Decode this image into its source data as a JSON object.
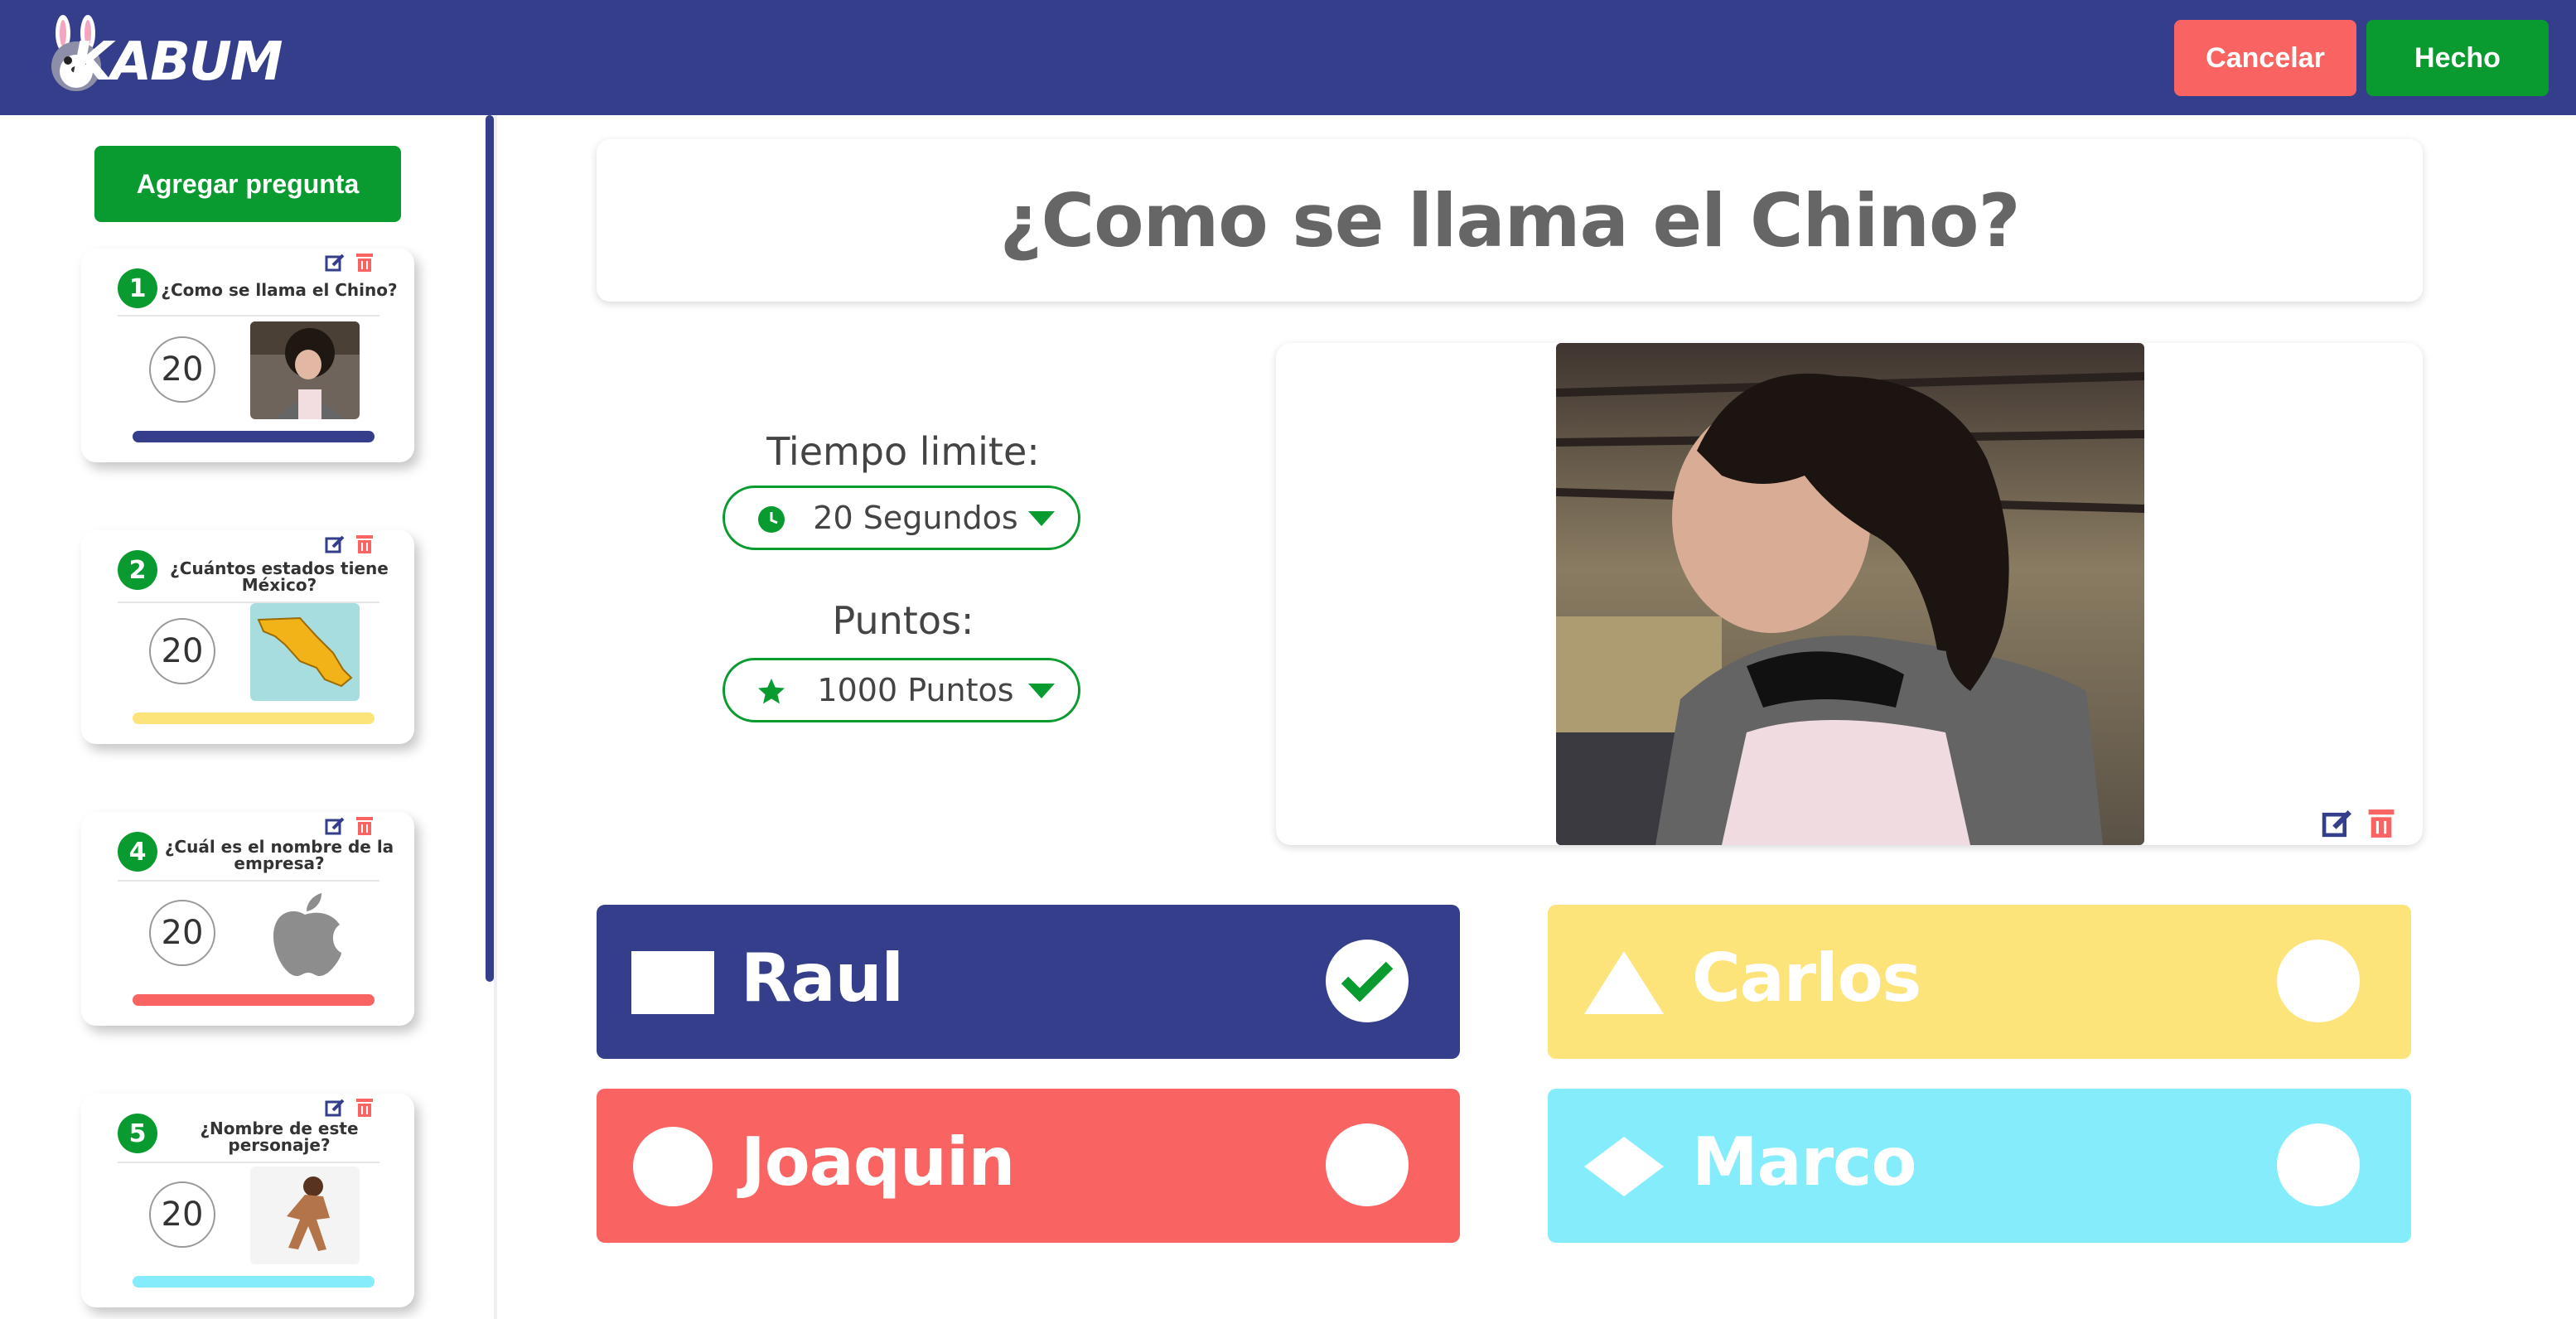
{
  "header": {
    "logo_text": "KABUM",
    "cancel_label": "Cancelar",
    "done_label": "Hecho"
  },
  "sidebar": {
    "add_label": "Agregar pregunta",
    "questions": [
      {
        "number": "1",
        "title": "¿Como se llama el Chino?",
        "time": "20",
        "color": "#343e8a"
      },
      {
        "number": "2",
        "title": "¿Cuántos estados tiene México?",
        "time": "20",
        "color": "#fde47a"
      },
      {
        "number": "4",
        "title": "¿Cuál es el nombre de la empresa?",
        "time": "20",
        "color": "#f96463"
      },
      {
        "number": "5",
        "title": "¿Nombre de este personaje?",
        "time": "20",
        "color": "#85ecfb"
      }
    ]
  },
  "main": {
    "question": "¿Como se llama el Chino?",
    "time_label": "Tiempo limite:",
    "time_value": "20 Segundos",
    "points_label": "Puntos:",
    "points_value": "1000 Puntos"
  },
  "answers": [
    {
      "text": "Raul",
      "shape": "square",
      "color": "#343e8a",
      "correct": true
    },
    {
      "text": "Carlos",
      "shape": "triangle",
      "color": "#fde47a",
      "correct": false
    },
    {
      "text": "Joaquin",
      "shape": "circle",
      "color": "#f96463",
      "correct": false
    },
    {
      "text": "Marco",
      "shape": "diamond",
      "color": "#85ecfb",
      "correct": false
    }
  ],
  "colors": {
    "header_bg": "#343e8a",
    "green": "#099b30",
    "red": "#f96463",
    "yellow": "#fde47a",
    "cyan": "#85ecfb"
  }
}
